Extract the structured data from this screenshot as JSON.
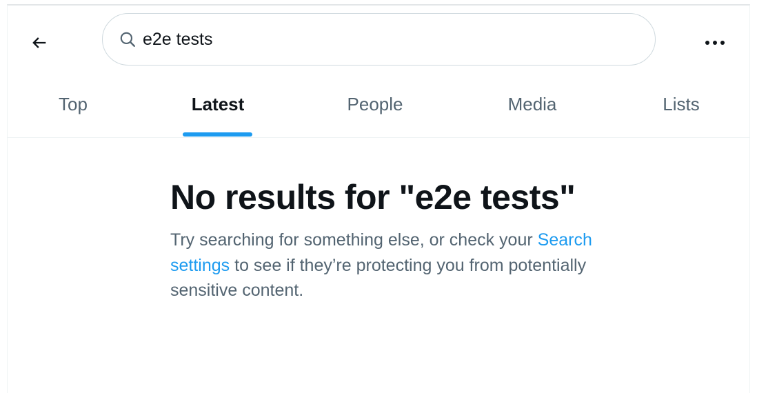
{
  "header": {
    "back_icon": "arrow-left-icon",
    "search": {
      "icon": "search-icon",
      "value": "e2e tests"
    },
    "more_icon": "more-horizontal-icon"
  },
  "tabs": [
    {
      "label": "Top",
      "active": false
    },
    {
      "label": "Latest",
      "active": true
    },
    {
      "label": "People",
      "active": false
    },
    {
      "label": "Media",
      "active": false
    },
    {
      "label": "Lists",
      "active": false
    }
  ],
  "empty_state": {
    "title": "No results for \"e2e tests\"",
    "body_prefix": "Try searching for something else, or check your ",
    "link_label": "Search settings",
    "body_suffix": " to see if they’re protecting you from potentially sensitive content."
  },
  "colors": {
    "accent": "#1d9bf0",
    "text_primary": "#0f1419",
    "text_secondary": "#536471",
    "border": "#cfd9de"
  }
}
